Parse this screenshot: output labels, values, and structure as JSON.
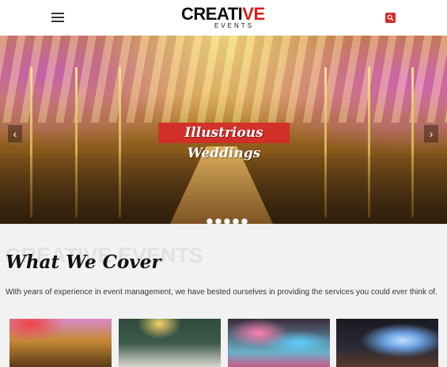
{
  "header": {
    "logo": {
      "main_prefix": "CREATI",
      "main_highlight": "VE",
      "sub": "EVENTS"
    },
    "menu_icon": "hamburger-icon",
    "search_icon": "search-icon",
    "search_color": "#d72a2a"
  },
  "hero": {
    "caption": "Illustrious Weddings",
    "prev_label": "‹",
    "next_label": "›",
    "slide_count": 5,
    "active_slide": 1,
    "caption_bg": "#d72828"
  },
  "section": {
    "watermark": "CREATIVE EVENTS",
    "title": "What We Cover",
    "description": "With years of experience in event management, we have bested ourselves in providing the services you could ever think of."
  }
}
